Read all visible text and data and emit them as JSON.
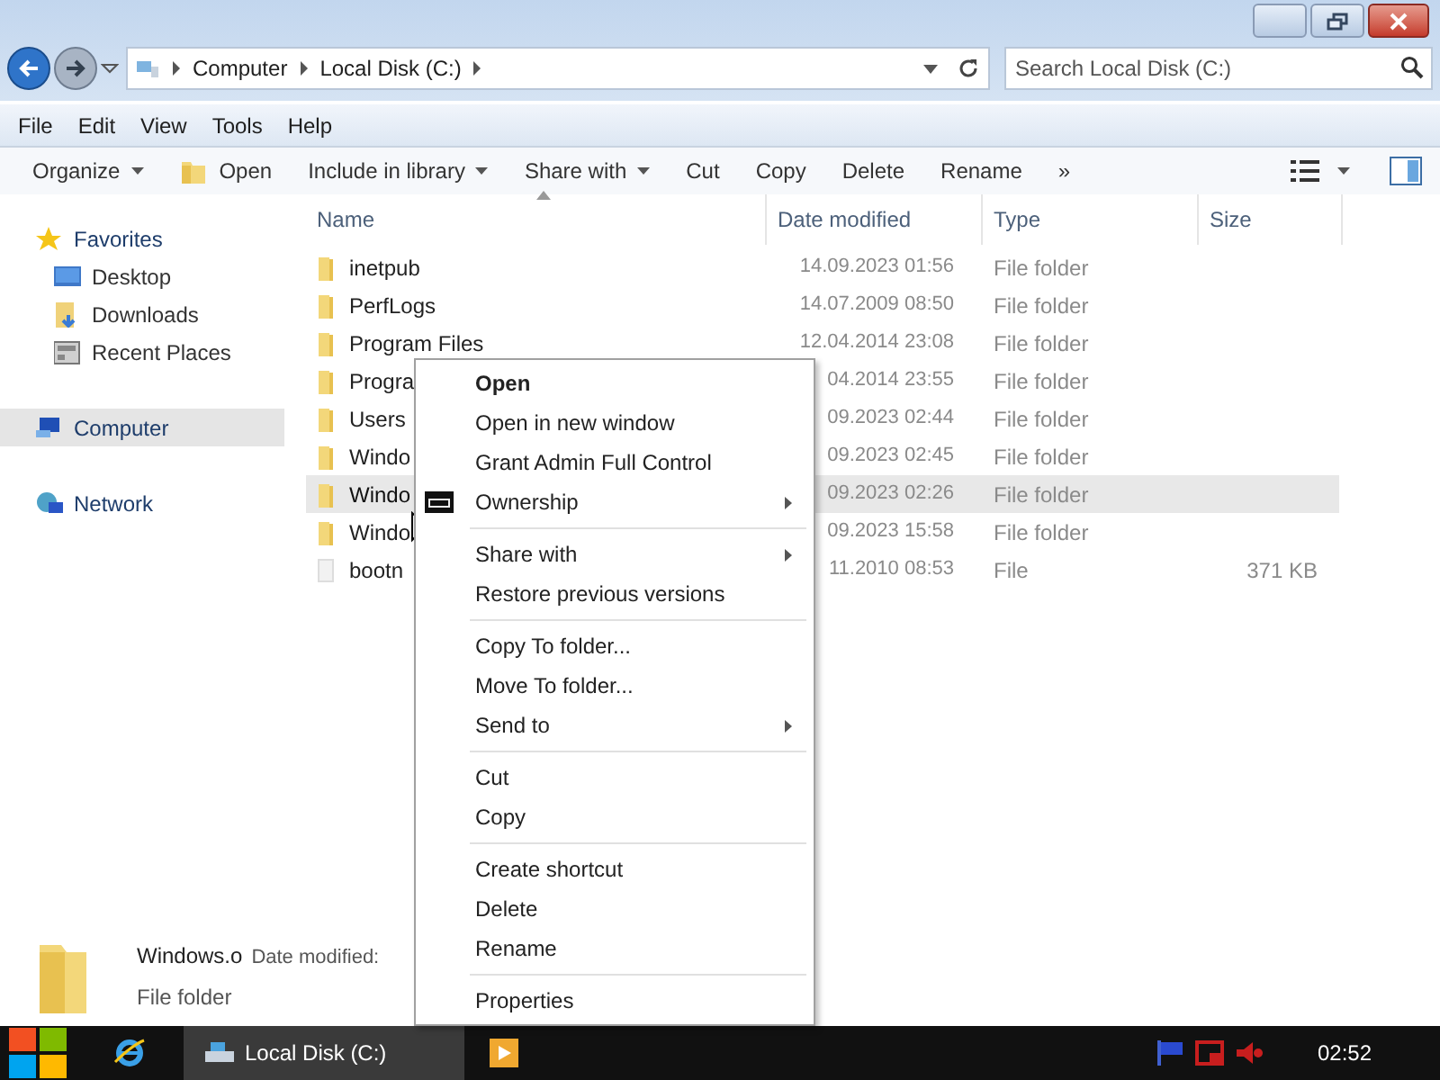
{
  "address_bar": {
    "breadcrumbs": [
      "Computer",
      "Local Disk (C:)"
    ]
  },
  "search": {
    "placeholder": "Search Local Disk (C:)"
  },
  "menu_bar": [
    "File",
    "Edit",
    "View",
    "Tools",
    "Help"
  ],
  "toolbar": [
    {
      "label": "Organize",
      "kind": "dropdown"
    },
    {
      "label": "Open",
      "kind": "folder"
    },
    {
      "label": "Include in library",
      "kind": "dropdown"
    },
    {
      "label": "Share with",
      "kind": "dropdown"
    },
    {
      "label": "Cut",
      "kind": "button"
    },
    {
      "label": "Copy",
      "kind": "button"
    },
    {
      "label": "Delete",
      "kind": "button"
    },
    {
      "label": "Rename",
      "kind": "button"
    },
    {
      "label": "»",
      "kind": "button"
    }
  ],
  "sidebar": [
    {
      "label": "Favorites",
      "kind": "star",
      "selected": false,
      "children": [
        {
          "label": "Desktop",
          "kind": "desktop",
          "selected": false
        },
        {
          "label": "Downloads",
          "kind": "downloads",
          "selected": false
        },
        {
          "label": "Recent Places",
          "kind": "recent",
          "selected": false
        }
      ]
    },
    {
      "label": "Computer",
      "kind": "computer",
      "selected": true
    },
    {
      "label": "Network",
      "kind": "network",
      "selected": false
    }
  ],
  "columns": [
    {
      "label": "Name",
      "sorted": true
    },
    {
      "label": "Date modified",
      "sorted": false
    },
    {
      "label": "Type",
      "sorted": false
    },
    {
      "label": "Size",
      "sorted": false
    }
  ],
  "rows": [
    {
      "name": "inetpub",
      "date": "14.09.2023 01:56",
      "type": "File folder",
      "kind": "folder",
      "selected": false
    },
    {
      "name": "PerfLogs",
      "date": "14.07.2009 08:50",
      "type": "File folder",
      "kind": "folder",
      "selected": false
    },
    {
      "name": "Program Files",
      "date": "12.04.2014 23:08",
      "type": "File folder",
      "kind": "folder",
      "selected": false
    },
    {
      "name": "Progra",
      "date": "04.2014 23:55",
      "type": "File folder",
      "kind": "folder",
      "selected": false
    },
    {
      "name": "Users",
      "date": "09.2023 02:44",
      "type": "File folder",
      "kind": "folder",
      "selected": false
    },
    {
      "name": "Windo",
      "date": "09.2023 02:45",
      "type": "File folder",
      "kind": "folder",
      "selected": false
    },
    {
      "name": "Windo",
      "date": "09.2023 02:26",
      "type": "File folder",
      "kind": "folder",
      "selected": true
    },
    {
      "name": "Windo",
      "date": "09.2023 15:58",
      "type": "File folder",
      "kind": "folder",
      "selected": false
    },
    {
      "name": "bootn",
      "date": "11.2010 08:53",
      "type": "File",
      "size": "371 KB",
      "kind": "file",
      "selected": false
    }
  ],
  "context_menu": [
    {
      "kind": "item",
      "label": "Open",
      "default": true,
      "submenu": false,
      "icon": false
    },
    {
      "kind": "item",
      "label": "Open in new window",
      "default": false,
      "submenu": false,
      "icon": false
    },
    {
      "kind": "item",
      "label": "Grant Admin Full Control",
      "default": false,
      "submenu": false,
      "icon": false
    },
    {
      "kind": "item",
      "label": "Ownership",
      "default": false,
      "submenu": true,
      "icon": true
    },
    {
      "kind": "separator"
    },
    {
      "kind": "item",
      "label": "Share with",
      "default": false,
      "submenu": true,
      "icon": false
    },
    {
      "kind": "item",
      "label": "Restore previous versions",
      "default": false,
      "submenu": false,
      "icon": false
    },
    {
      "kind": "separator"
    },
    {
      "kind": "item",
      "label": "Copy To folder...",
      "default": false,
      "submenu": false,
      "icon": false
    },
    {
      "kind": "item",
      "label": "Move To folder...",
      "default": false,
      "submenu": false,
      "icon": false
    },
    {
      "kind": "item",
      "label": "Send to",
      "default": false,
      "submenu": true,
      "icon": false
    },
    {
      "kind": "separator"
    },
    {
      "kind": "item",
      "label": "Cut",
      "default": false,
      "submenu": false,
      "icon": false
    },
    {
      "kind": "item",
      "label": "Copy",
      "default": false,
      "submenu": false,
      "icon": false
    },
    {
      "kind": "separator"
    },
    {
      "kind": "item",
      "label": "Create shortcut",
      "default": false,
      "submenu": false,
      "icon": false
    },
    {
      "kind": "item",
      "label": "Delete",
      "default": false,
      "submenu": false,
      "icon": false
    },
    {
      "kind": "item",
      "label": "Rename",
      "default": false,
      "submenu": false,
      "icon": false
    },
    {
      "kind": "separator"
    },
    {
      "kind": "item",
      "label": "Properties",
      "default": false,
      "submenu": false,
      "icon": false
    }
  ],
  "details": {
    "name": "Windows.o",
    "date_label": "Date modified:",
    "type": "File folder"
  },
  "taskbar": {
    "window_button": {
      "label": "Local Disk (C:)",
      "selected": true
    },
    "clock": "02:52"
  }
}
